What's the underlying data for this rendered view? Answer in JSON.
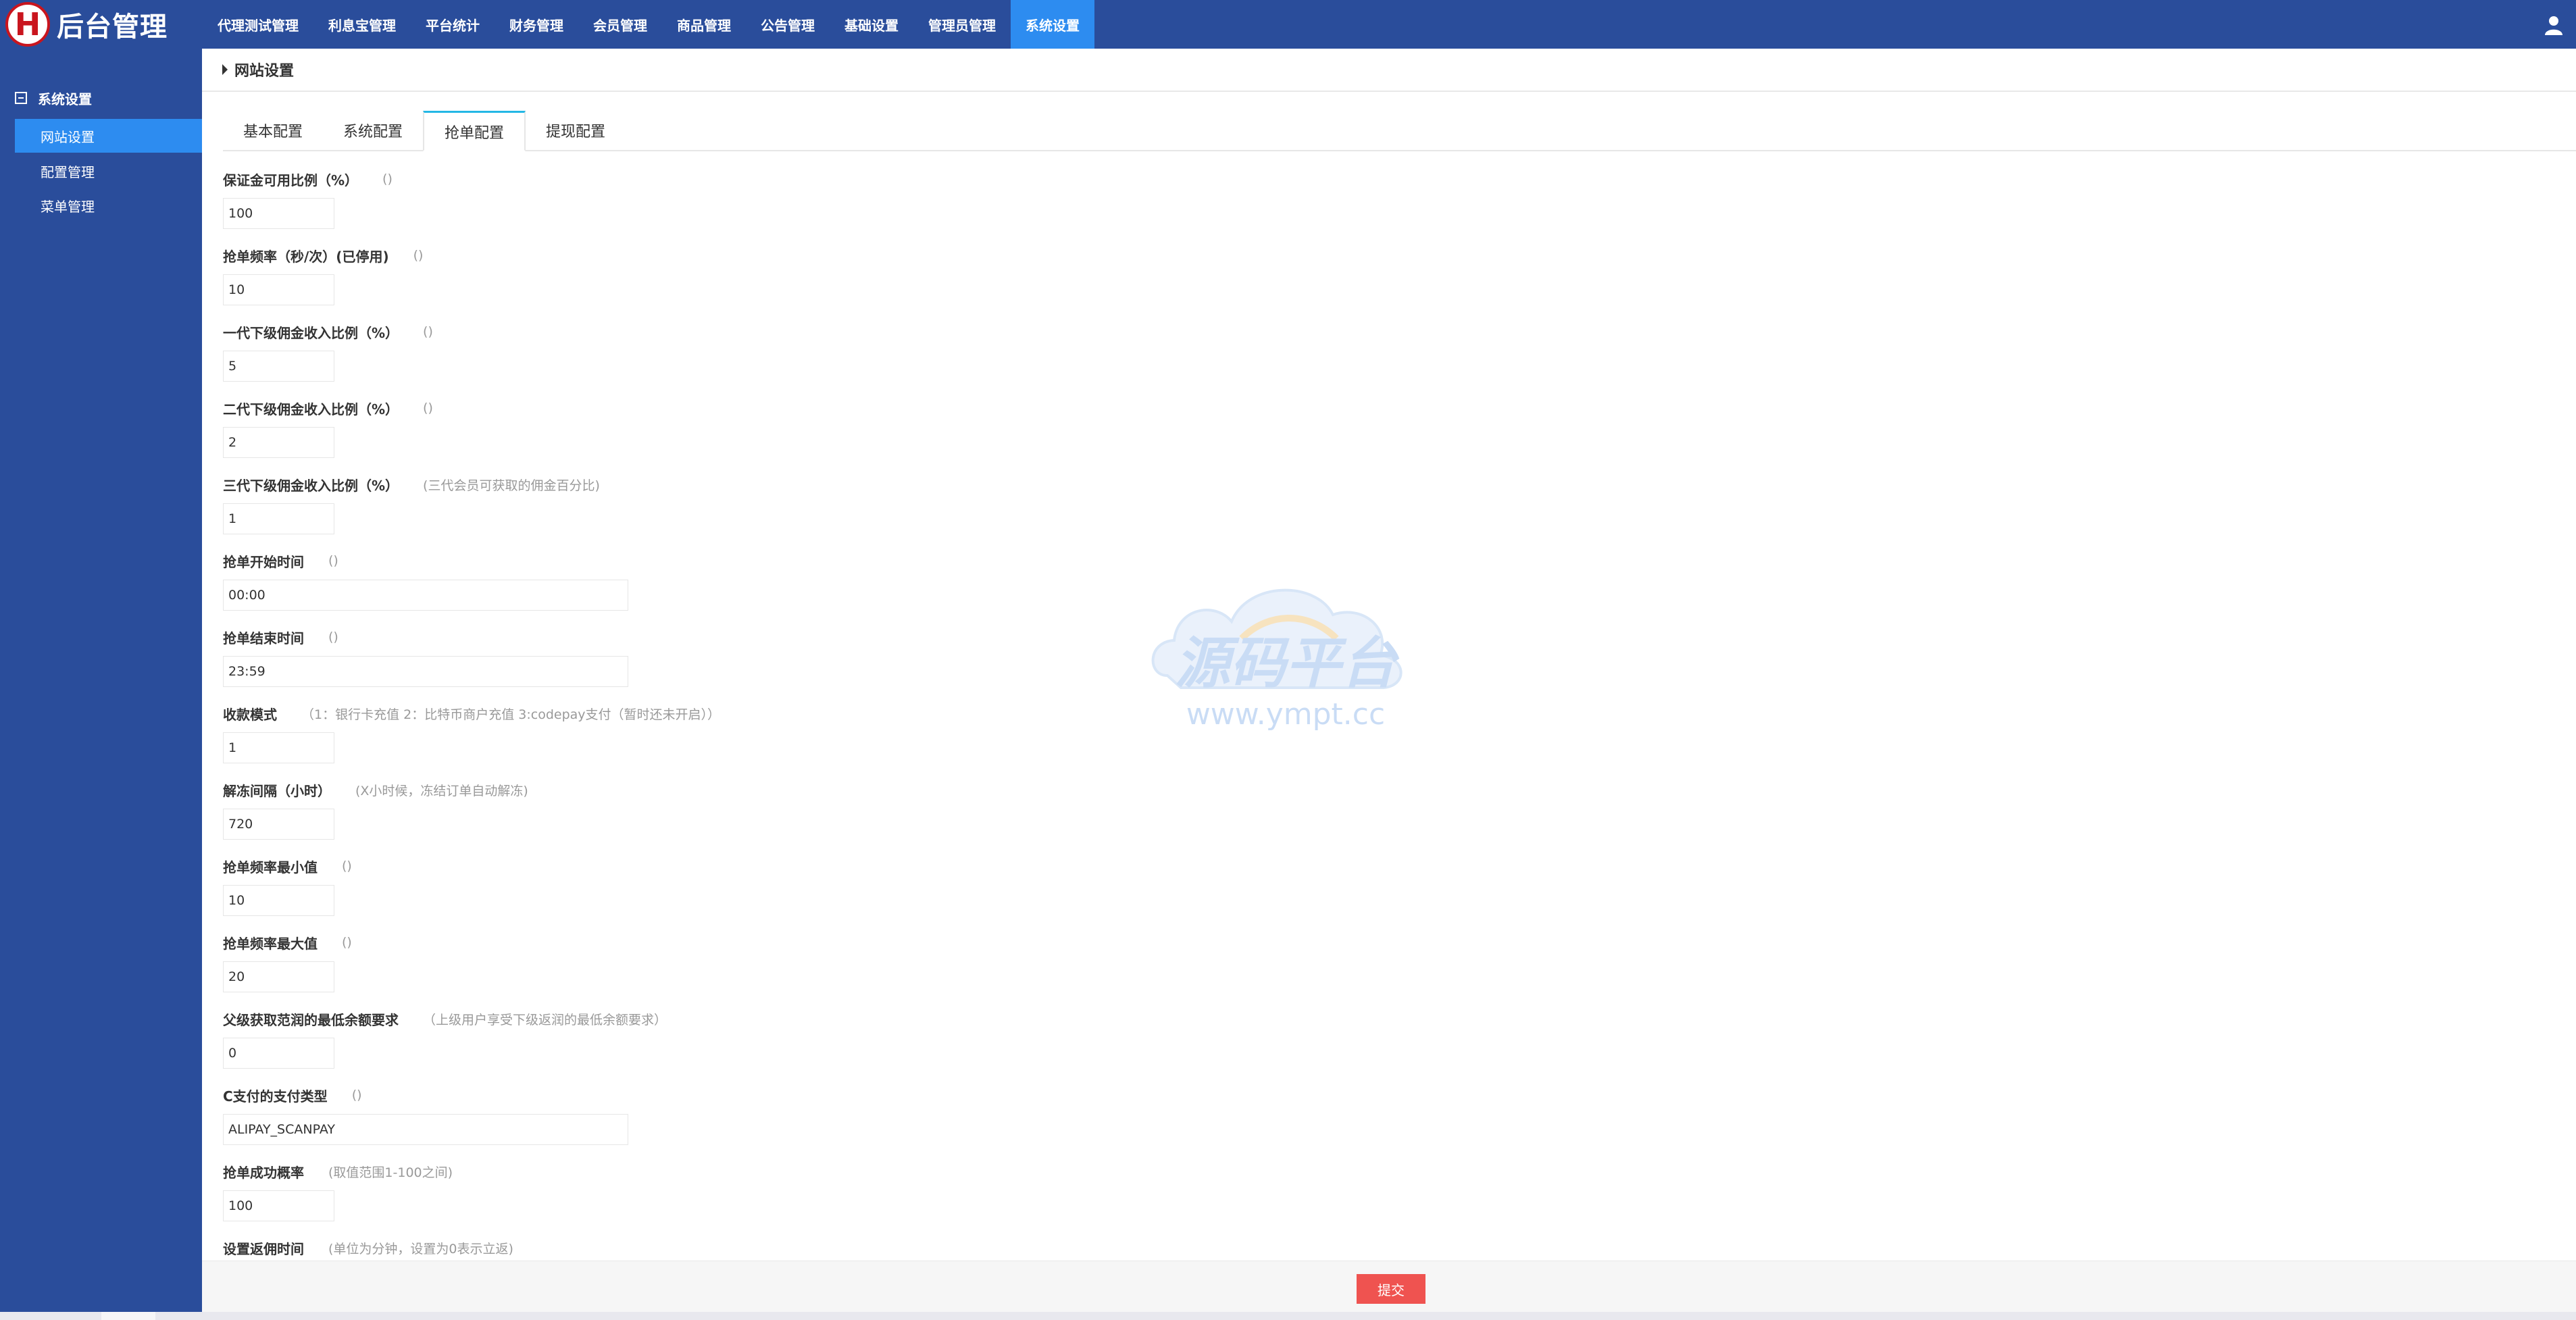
{
  "app": {
    "logo_letter": "H",
    "title": "后台管理",
    "brand_color": "#2a4d9b",
    "active_color": "#2d8cf0",
    "logo_color": "#c9151e"
  },
  "topnav": {
    "items": [
      "代理测试管理",
      "利息宝管理",
      "平台统计",
      "财务管理",
      "会员管理",
      "商品管理",
      "公告管理",
      "基础设置",
      "管理员管理",
      "系统设置"
    ],
    "active_index": 9,
    "user_icon": "user-icon"
  },
  "sidebar": {
    "group_label": "系统设置",
    "group_icon": "minus-square-icon",
    "items": [
      "网站设置",
      "配置管理",
      "菜单管理"
    ],
    "active_index": 0
  },
  "breadcrumb": {
    "title": "网站设置"
  },
  "tabs": {
    "items": [
      "基本配置",
      "系统配置",
      "抢单配置",
      "提现配置"
    ],
    "active_index": 2,
    "accent": "#23b7e5"
  },
  "form": {
    "fields": [
      {
        "label": "保证金可用比例（%）",
        "hint": "()",
        "value": "100",
        "wide": false
      },
      {
        "label": "抢单频率（秒/次）(已停用)",
        "hint": "()",
        "value": "10",
        "wide": false
      },
      {
        "label": "一代下级佣金收入比例（%）",
        "hint": "()",
        "value": "5",
        "wide": false
      },
      {
        "label": "二代下级佣金收入比例（%）",
        "hint": "()",
        "value": "2",
        "wide": false
      },
      {
        "label": "三代下级佣金收入比例（%）",
        "hint": "(三代会员可获取的佣金百分比)",
        "value": "1",
        "wide": false
      },
      {
        "label": "抢单开始时间",
        "hint": "()",
        "value": "00:00",
        "wide": true
      },
      {
        "label": "抢单结束时间",
        "hint": "()",
        "value": "23:59",
        "wide": true
      },
      {
        "label": "收款模式",
        "hint": "（1：银行卡充值 2：比特币商户充值 3:codepay支付（暂时还未开启））",
        "value": "1",
        "wide": false
      },
      {
        "label": "解冻间隔（小时）",
        "hint": "(X小时候，冻结订单自动解冻)",
        "value": "720",
        "wide": false
      },
      {
        "label": "抢单频率最小值",
        "hint": "()",
        "value": "10",
        "wide": false
      },
      {
        "label": "抢单频率最大值",
        "hint": "()",
        "value": "20",
        "wide": false
      },
      {
        "label": "父级获取范润的最低余额要求",
        "hint": "（上级用户享受下级返润的最低余额要求）",
        "value": "0",
        "wide": false
      },
      {
        "label": "C支付的支付类型",
        "hint": "()",
        "value": "ALIPAY_SCANPAY",
        "wide": true
      },
      {
        "label": "抢单成功概率",
        "hint": "(取值范围1-100之间)",
        "value": "100",
        "wide": false
      },
      {
        "label": "设置返佣时间",
        "hint": "(单位为分钟，设置为0表示立返)",
        "value": "",
        "wide": false
      }
    ]
  },
  "footer": {
    "submit_label": "提交",
    "submit_color": "#ef5350"
  },
  "watermark": {
    "text": "源码平台",
    "url": "www.ympt.cc"
  }
}
